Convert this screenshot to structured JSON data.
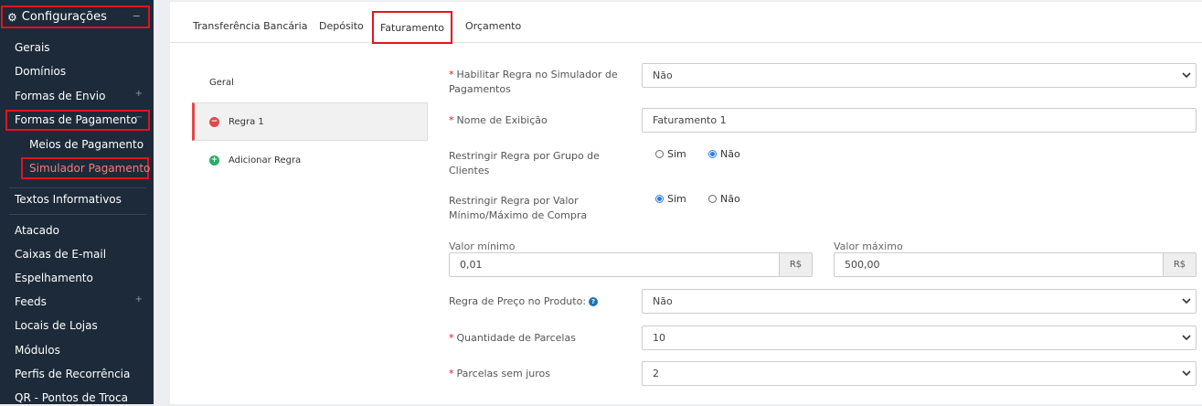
{
  "sidebar": {
    "header": "Configurações",
    "items": {
      "gerais": "Gerais",
      "dominios": "Domínios",
      "formas_envio": "Formas de Envio",
      "formas_pagamento": "Formas de Pagamento",
      "meios_pagamento": "Meios de Pagamento",
      "simulador_pagamento": "Simulador Pagamento",
      "textos_informativos": "Textos Informativos",
      "atacado": "Atacado",
      "caixas_email": "Caixas de E-mail",
      "espelhamento": "Espelhamento",
      "feeds": "Feeds",
      "locais_lojas": "Locais de Lojas",
      "modulos": "Módulos",
      "perfis_recorrencia": "Perfis de Recorrência",
      "qr_pontos_troca": "QR - Pontos de Troca"
    }
  },
  "tabs": {
    "transferencia": "Transferência Bancária",
    "deposito": "Depósito",
    "faturamento": "Faturamento",
    "orcamento": "Orçamento"
  },
  "leftnav": {
    "geral": "Geral",
    "regra1": "Regra 1",
    "adicionar": "Adicionar Regra"
  },
  "form": {
    "habilitar_label": "Habilitar Regra no Simulador de Pagamentos",
    "habilitar_value": "Não",
    "nome_label": "Nome de Exibição",
    "nome_value": "Faturamento 1",
    "grupo_label": "Restringir Regra por Grupo de Clientes",
    "grupo_sim": "Sim",
    "grupo_nao": "Não",
    "valor_label": "Restringir Regra por Valor Mínimo/Máximo de Compra",
    "valor_sim": "Sim",
    "valor_nao": "Não",
    "valor_min_label": "Valor mínimo",
    "valor_min": "0,01",
    "valor_max_label": "Valor máximo",
    "valor_max": "500,00",
    "currency": "R$",
    "preco_label": "Regra de Preço no Produto:",
    "preco_value": "Não",
    "parcelas_label": "Quantidade de Parcelas",
    "parcelas_value": "10",
    "sem_juros_label": "Parcelas sem juros",
    "sem_juros_value": "2"
  },
  "colors": {
    "sidebar_bg": "#1c2a39",
    "highlight": "#e0151d",
    "radio_active": "#2d7be5",
    "remove_icon": "#e04a4a",
    "add_icon": "#27ae60"
  }
}
